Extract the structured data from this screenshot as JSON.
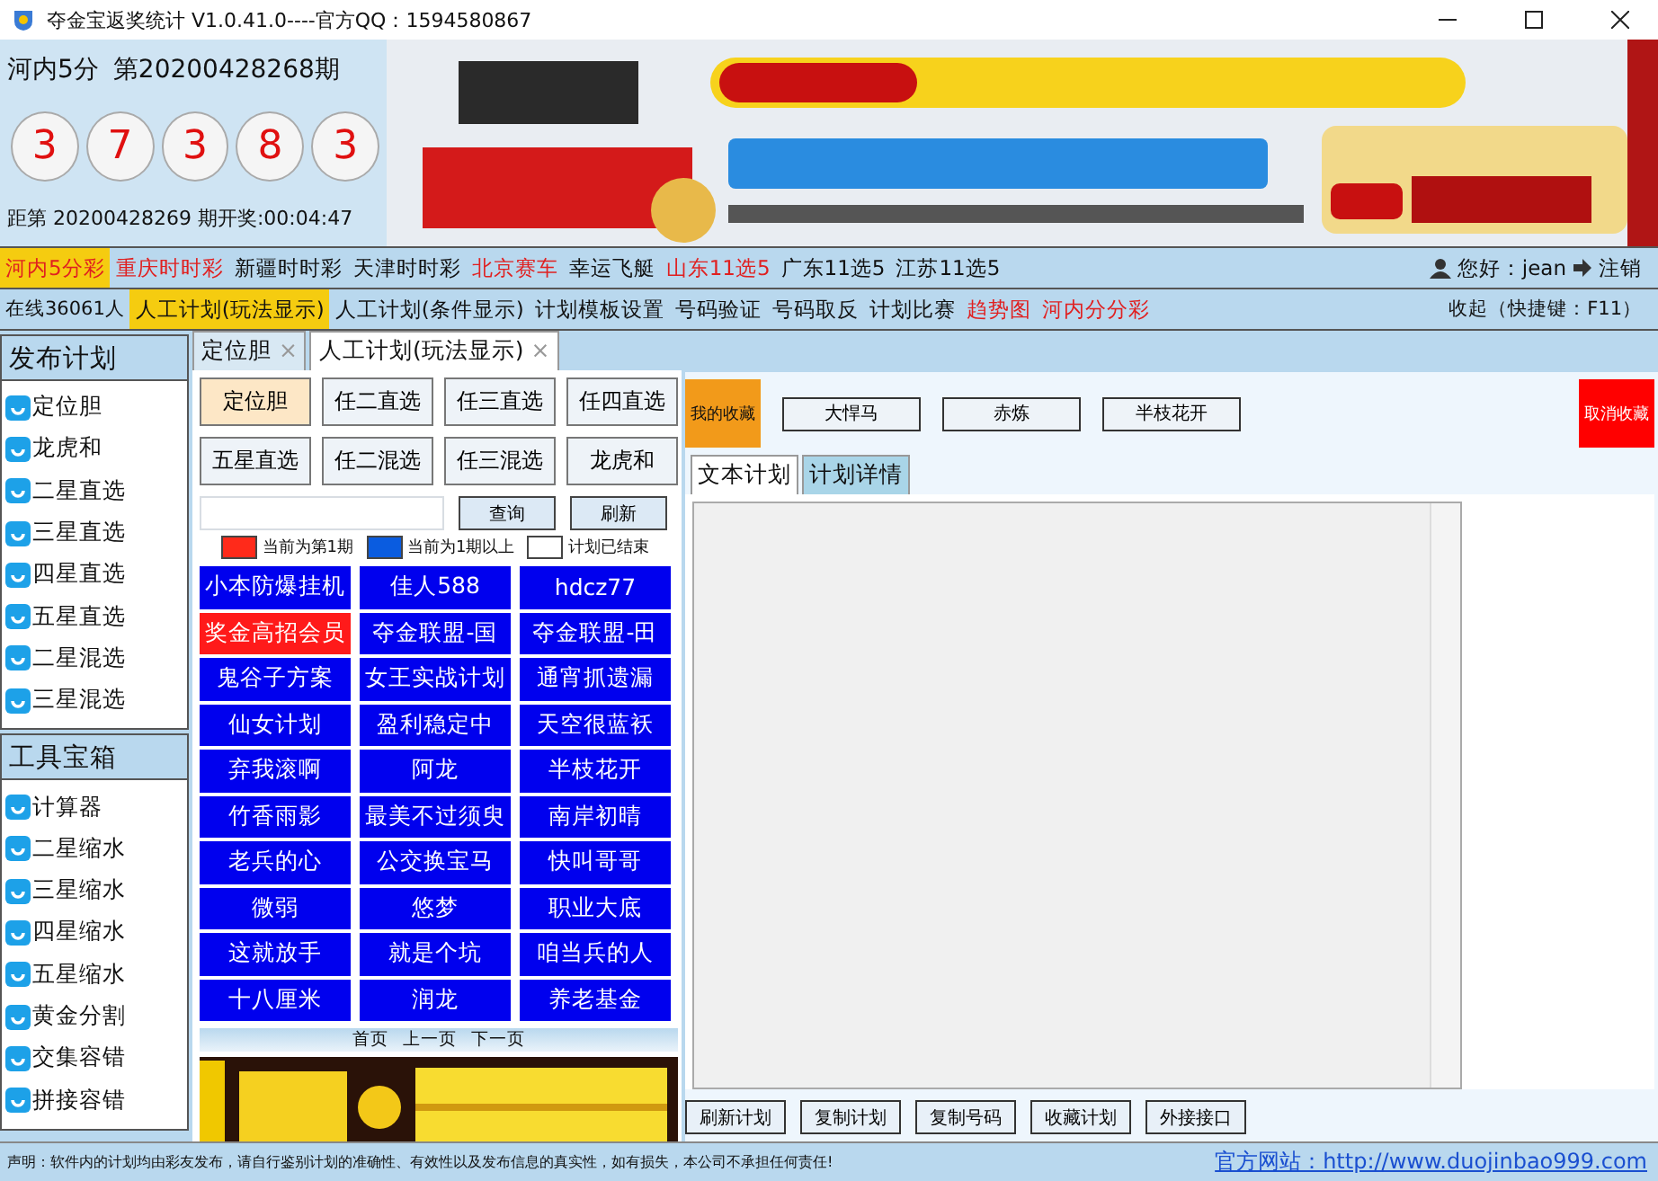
{
  "window": {
    "title": "夺金宝返奖统计  V1.0.41.0----官方QQ：1594580867"
  },
  "draw": {
    "lottery": "河内5分",
    "issue": "第20200428268期",
    "balls": [
      "3",
      "7",
      "3",
      "8",
      "3"
    ],
    "countdown": "距第 20200428269 期开奖:00:04:47"
  },
  "banner": {
    "kind": "picture"
  },
  "lottery_menu": [
    {
      "label": "河内5分彩",
      "selected": true,
      "color": "#e02020"
    },
    {
      "label": "重庆时时彩",
      "selected": false,
      "color": "#e02020"
    },
    {
      "label": "新疆时时彩",
      "selected": false,
      "color": "#111111"
    },
    {
      "label": "天津时时彩",
      "selected": false,
      "color": "#111111"
    },
    {
      "label": "北京赛车",
      "selected": false,
      "color": "#e02020"
    },
    {
      "label": "幸运飞艇",
      "selected": false,
      "color": "#111111"
    },
    {
      "label": "山东11选5",
      "selected": false,
      "color": "#e02020"
    },
    {
      "label": "广东11选5",
      "selected": false,
      "color": "#111111"
    },
    {
      "label": "江苏11选5",
      "selected": false,
      "color": "#111111"
    }
  ],
  "user": {
    "greeting": "您好：jean",
    "logout": "注销"
  },
  "online": "在线36061人",
  "function_menu": [
    {
      "label": "人工计划(玩法显示)",
      "selected": true,
      "color": "#111111"
    },
    {
      "label": "人工计划(条件显示)",
      "selected": false,
      "color": "#111111"
    },
    {
      "label": "计划模板设置",
      "selected": false,
      "color": "#111111"
    },
    {
      "label": "号码验证",
      "selected": false,
      "color": "#111111"
    },
    {
      "label": "号码取反",
      "selected": false,
      "color": "#111111"
    },
    {
      "label": "计划比赛",
      "selected": false,
      "color": "#111111"
    },
    {
      "label": "趋势图",
      "selected": false,
      "color": "#e02020"
    },
    {
      "label": "河内分分彩",
      "selected": false,
      "color": "#e02020"
    }
  ],
  "collapse": "收起（快捷键：F11）",
  "sidebar": [
    {
      "title": "发布计划",
      "items": [
        "定位胆",
        "龙虎和",
        "二星直选",
        "三星直选",
        "四星直选",
        "五星直选",
        "二星混选",
        "三星混选"
      ]
    },
    {
      "title": "工具宝箱",
      "items": [
        "计算器",
        "二星缩水",
        "三星缩水",
        "四星缩水",
        "五星缩水",
        "黄金分割",
        "交集容错",
        "拼接容错"
      ]
    }
  ],
  "tabs": [
    {
      "label": "定位胆",
      "selected": false,
      "close": "×"
    },
    {
      "label": "人工计划(玩法显示)",
      "selected": true,
      "close": "×"
    }
  ],
  "play_types": [
    {
      "label": "定位胆",
      "selected": true
    },
    {
      "label": "任二直选",
      "selected": false
    },
    {
      "label": "任三直选",
      "selected": false
    },
    {
      "label": "任四直选",
      "selected": false
    },
    {
      "label": "五星直选",
      "selected": false
    },
    {
      "label": "任二混选",
      "selected": false
    },
    {
      "label": "任三混选",
      "selected": false
    },
    {
      "label": "龙虎和",
      "selected": false
    }
  ],
  "search_buttons": [
    "查询",
    "刷新"
  ],
  "legend": [
    {
      "label": "当前为第1期",
      "color": "#ff2a1a"
    },
    {
      "label": "当前为1期以上",
      "color": "#0a5ce0"
    },
    {
      "label": "计划已结束",
      "color": "#ffffff"
    }
  ],
  "plans": [
    {
      "name": "小本防爆挂机",
      "color": "#0000ee"
    },
    {
      "name": "佳人588",
      "color": "#0000ee"
    },
    {
      "name": "hdcz77",
      "color": "#0000ee"
    },
    {
      "name": "奖金高招会员",
      "color": "#ff1a1a"
    },
    {
      "name": "夺金联盟-国",
      "color": "#0000ee"
    },
    {
      "name": "夺金联盟-田",
      "color": "#0000ee"
    },
    {
      "name": "鬼谷子方案",
      "color": "#0000ee"
    },
    {
      "name": "女王实战计划",
      "color": "#0000ee"
    },
    {
      "name": "通宵抓遗漏",
      "color": "#0000ee"
    },
    {
      "name": "仙女计划",
      "color": "#0000ee"
    },
    {
      "name": "盈利稳定中",
      "color": "#0000ee"
    },
    {
      "name": "天空很蓝袄",
      "color": "#0000ee"
    },
    {
      "name": "弃我滚啊",
      "color": "#0000ee"
    },
    {
      "name": "阿龙",
      "color": "#0000ee"
    },
    {
      "name": "半枝花开",
      "color": "#0000ee"
    },
    {
      "name": "竹香雨影",
      "color": "#0000ee"
    },
    {
      "name": "最美不过须臾",
      "color": "#0000ee"
    },
    {
      "name": "南岸初晴",
      "color": "#0000ee"
    },
    {
      "name": "老兵的心",
      "color": "#0000ee"
    },
    {
      "name": "公交换宝马",
      "color": "#0000ee"
    },
    {
      "name": "快叫哥哥",
      "color": "#0000ee"
    },
    {
      "name": "微弱",
      "color": "#0000ee"
    },
    {
      "name": "悠梦",
      "color": "#0000ee"
    },
    {
      "name": "职业大底",
      "color": "#0000ee"
    },
    {
      "name": "这就放手",
      "color": "#0000ee"
    },
    {
      "name": "就是个坑",
      "color": "#0000ee"
    },
    {
      "name": "咱当兵的人",
      "color": "#0000ee"
    },
    {
      "name": "十八厘米",
      "color": "#0000ee"
    },
    {
      "name": "润龙",
      "color": "#0000ee"
    },
    {
      "name": "养老基金",
      "color": "#0000ee"
    }
  ],
  "pager": [
    "首页",
    "上一页",
    "下一页"
  ],
  "ad": {
    "kind": "picture"
  },
  "favorites": {
    "label": "我的收藏",
    "items": [
      "大悍马",
      "赤炼",
      "半枝花开"
    ],
    "remove": "取消收藏"
  },
  "detail_tabs": [
    {
      "label": "文本计划",
      "selected": true
    },
    {
      "label": "计划详情",
      "selected": false
    }
  ],
  "actions": [
    "刷新计划",
    "复制计划",
    "复制号码",
    "收藏计划",
    "外接接口"
  ],
  "footer": {
    "notice": "声明：软件内的计划均由彩友发布，请自行鉴别计划的准确性、有效性以及发布信息的真实性，如有损失，本公司不承担任何责任!",
    "website": "官方网站：http://www.duojinbao999.com"
  }
}
